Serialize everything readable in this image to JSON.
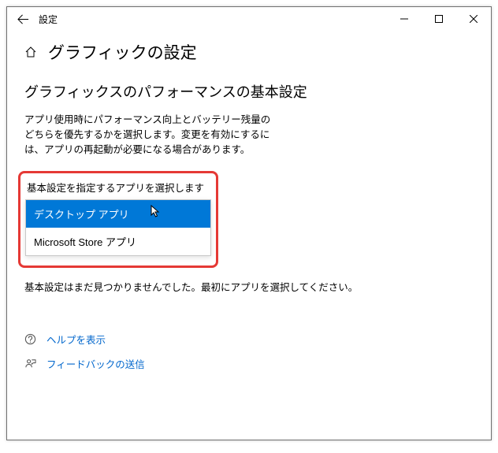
{
  "titlebar": {
    "title": "設定"
  },
  "page": {
    "title": "グラフィックの設定"
  },
  "section": {
    "title": "グラフィックスのパフォーマンスの基本設定",
    "description": "アプリ使用時にパフォーマンス向上とバッテリー残量のどちらを優先するかを選択します。変更を有効にするには、アプリの再起動が必要になる場合があります。"
  },
  "dropdown": {
    "label": "基本設定を指定するアプリを選択します",
    "items": [
      {
        "label": "デスクトップ アプリ"
      },
      {
        "label": "Microsoft Store アプリ"
      }
    ]
  },
  "no_prefs_text": "基本設定はまだ見つかりませんでした。最初にアプリを選択してください。",
  "links": {
    "help": "ヘルプを表示",
    "feedback": "フィードバックの送信"
  }
}
